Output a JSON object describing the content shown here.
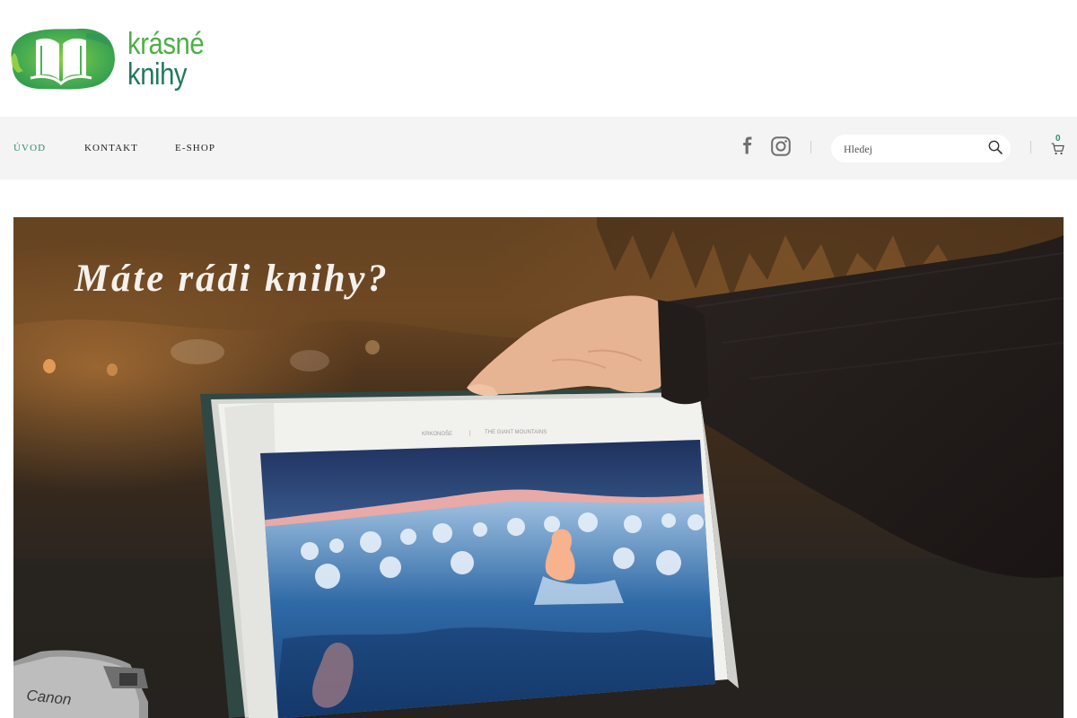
{
  "brand": {
    "name_part1": "krásné",
    "name_part2": "knihy",
    "colors": {
      "light_green": "#4daf47",
      "dark_green": "#22795b"
    }
  },
  "nav": {
    "items": [
      {
        "label": "ÚVOD",
        "active": true
      },
      {
        "label": "KONTAKT",
        "active": false
      },
      {
        "label": "E-SHOP",
        "active": false
      }
    ],
    "active_color": "#2f8f6a"
  },
  "social": {
    "icons": [
      "facebook-icon",
      "instagram-icon"
    ]
  },
  "search": {
    "placeholder": "Hledej",
    "value": ""
  },
  "cart": {
    "count": "0"
  },
  "hero": {
    "title": "Máte rádi knihy?",
    "image": "photo of a hand holding an open photo book showing a snowy mountain sunset"
  }
}
